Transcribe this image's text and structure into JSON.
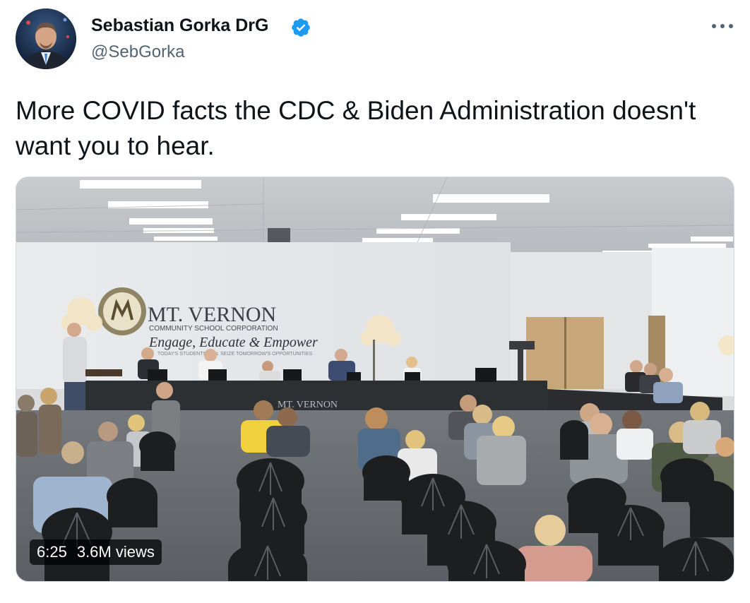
{
  "author": {
    "display_name": "Sebastian Gorka DrG",
    "handle": "@SebGorka",
    "verified": true,
    "verified_color": "#1d9bf0"
  },
  "tweet": {
    "text": "More COVID facts the CDC & Biden Administration doesn't want you to hear."
  },
  "media": {
    "type": "video",
    "duration": "6:25",
    "views": "3.6M views",
    "scene_text": {
      "org_name": "MT. VERNON",
      "org_sub": "COMMUNITY SCHOOL CORPORATION",
      "motto": "Engage, Educate & Empower",
      "tagline": "TODAY'S STUDENTS WILL SEIZE TOMORROW'S OPPORTUNITIES",
      "table_banner": "MT. VERNON"
    }
  },
  "icons": {
    "more": "more-horizontal-icon",
    "verified": "verified-badge-icon"
  }
}
